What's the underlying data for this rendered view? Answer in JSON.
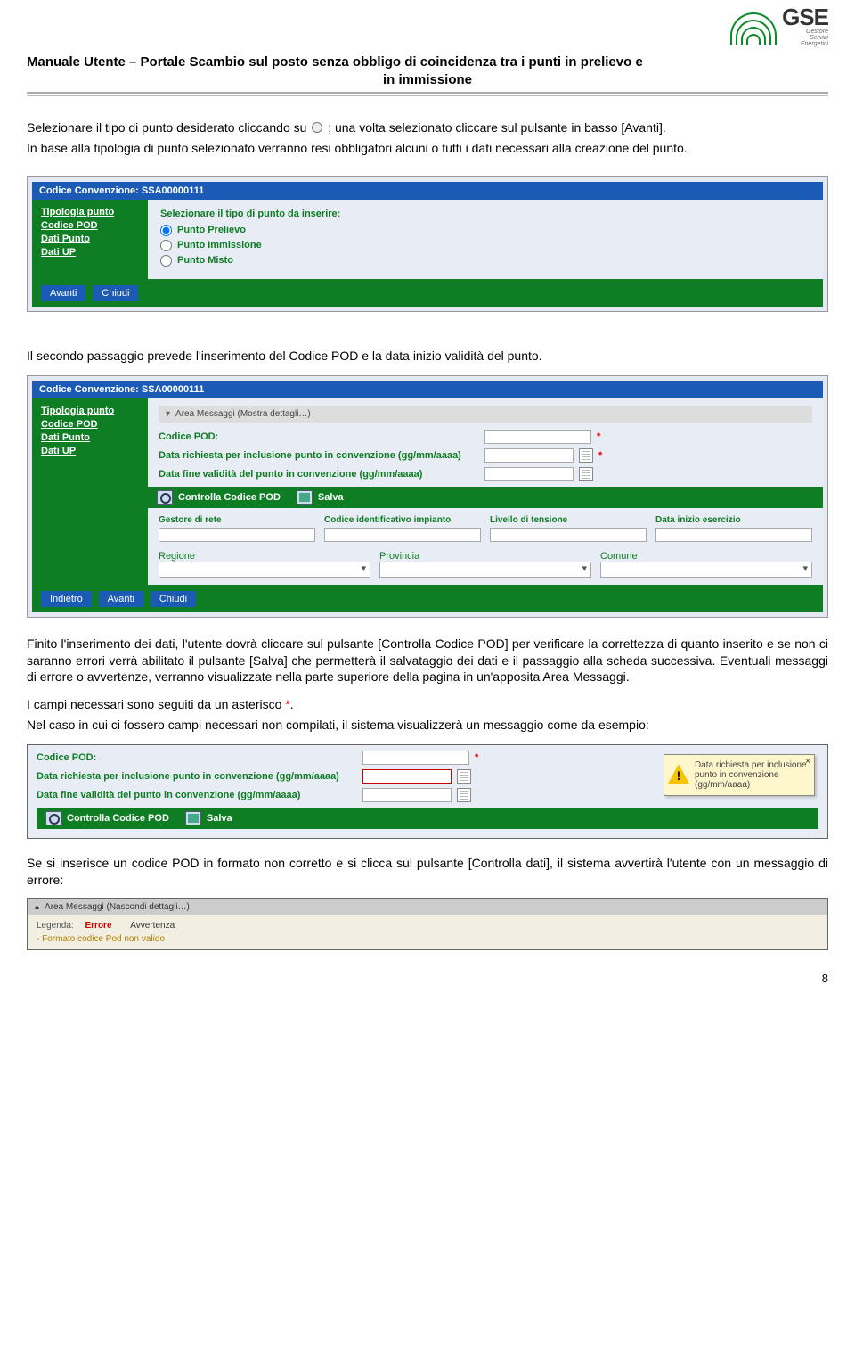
{
  "logo": {
    "abbr": "GSE",
    "line1": "Gestore",
    "line2": "Servizi",
    "line3": "Energetici"
  },
  "doc_title": {
    "line1": "Manuale Utente – Portale Scambio sul posto senza obbligo di coincidenza tra i punti in prelievo e",
    "line2": "in immissione"
  },
  "intro": {
    "p1a": "Selezionare il tipo di punto desiderato cliccando su ",
    "p1b": "; una volta selezionato cliccare sul pulsante in basso [Avanti].",
    "p2": "In base alla tipologia di punto selezionato verranno resi obbligatori alcuni o tutti i dati necessari alla creazione del punto."
  },
  "panel1": {
    "codice_label": "Codice Convenzione:",
    "codice_value": "SSA00000111",
    "sidemenu": [
      "Tipologia punto",
      "Codice POD",
      "Dati Punto",
      "Dati UP"
    ],
    "prompt": "Selezionare il tipo di punto da inserire:",
    "options": [
      "Punto Prelievo",
      "Punto Immissione",
      "Punto Misto"
    ],
    "buttons": {
      "avanti": "Avanti",
      "chiudi": "Chiudi"
    }
  },
  "mid_text": "Il secondo passaggio prevede l'inserimento del Codice POD e la data inizio validità del punto.",
  "panel2": {
    "codice_label": "Codice Convenzione:",
    "codice_value": "SSA00000111",
    "sidemenu": [
      "Tipologia punto",
      "Codice POD",
      "Dati Punto",
      "Dati UP"
    ],
    "area_msg": "Area Messaggi (Mostra dettagli…)",
    "labels": {
      "codice_pod": "Codice POD:",
      "data_incl": "Data richiesta per inclusione punto in convenzione (gg/mm/aaaa)",
      "data_fine": "Data fine validità del punto in convenzione (gg/mm/aaaa)"
    },
    "actions": {
      "controlla": "Controlla Codice POD",
      "salva": "Salva"
    },
    "grid": [
      "Gestore di rete",
      "Codice identificativo impianto",
      "Livello di tensione",
      "Data inizio esercizio"
    ],
    "grid2": [
      "Regione",
      "Provincia",
      "Comune"
    ],
    "buttons": {
      "indietro": "Indietro",
      "avanti": "Avanti",
      "chiudi": "Chiudi"
    }
  },
  "after_panel2": {
    "p1": "Finito l'inserimento dei dati, l'utente dovrà cliccare sul pulsante [Controlla Codice POD] per verificare la correttezza di quanto inserito e se non ci saranno errori verrà abilitato il pulsante [Salva] che permetterà il salvataggio dei dati e il passaggio alla scheda successiva. Eventuali messaggi di errore o avvertenze, verranno visualizzate nella parte superiore della pagina in un'apposita Area Messaggi.",
    "p2a": "I campi necessari sono seguiti da un asterisco ",
    "p2b": ".",
    "p3": "Nel caso in cui ci fossero campi necessari non compilati, il sistema visualizzerà un messaggio come da esempio:"
  },
  "panel3": {
    "labels": {
      "codice_pod": "Codice POD:",
      "data_incl": "Data richiesta per inclusione punto in convenzione (gg/mm/aaaa)",
      "data_fine": "Data fine validità del punto in convenzione (gg/mm/aaaa)"
    },
    "actions": {
      "controlla": "Controlla Codice POD",
      "salva": "Salva"
    },
    "tooltip": "Data richiesta per inclusione punto in convenzione (gg/mm/aaaa)"
  },
  "after_panel3": "Se si inserisce un codice POD in formato non corretto e si clicca sul pulsante [Controlla dati], il sistema avvertirà l'utente con un messaggio di errore:",
  "panel4": {
    "head": "Area Messaggi  (Nascondi dettagli…)",
    "legend_label": "Legenda:",
    "legend_err": "Errore",
    "legend_warn": "Avvertenza",
    "msg": "- Formato codice Pod non valido"
  },
  "page_number": "8"
}
